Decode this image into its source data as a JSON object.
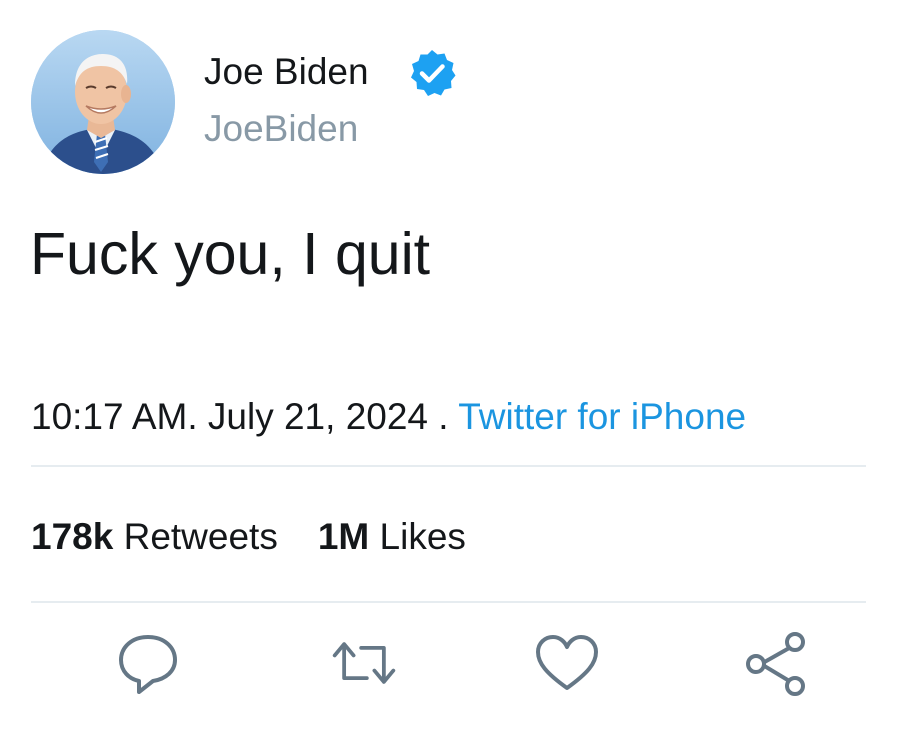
{
  "author": {
    "display_name": "Joe Biden",
    "handle": "JoeBiden",
    "verified": true,
    "avatar_icon": "profile-photo"
  },
  "tweet": {
    "text": "Fuck you, I quit",
    "time": "10:17 AM",
    "date": "July 21, 2024",
    "source": "Twitter for iPhone"
  },
  "stats": {
    "retweets_count": "178k",
    "retweets_label": "Retweets",
    "likes_count": "1M",
    "likes_label": "Likes"
  },
  "actions": [
    {
      "name": "reply",
      "icon": "speech-bubble-icon"
    },
    {
      "name": "retweet",
      "icon": "retweet-arrows-icon"
    },
    {
      "name": "like",
      "icon": "heart-icon"
    },
    {
      "name": "share",
      "icon": "share-nodes-icon"
    }
  ],
  "colors": {
    "text": "#14171a",
    "secondary": "#8899a6",
    "link": "#1b95e0",
    "verified": "#1da1f2",
    "icon": "#657786",
    "divider": "#e6ecf0"
  }
}
